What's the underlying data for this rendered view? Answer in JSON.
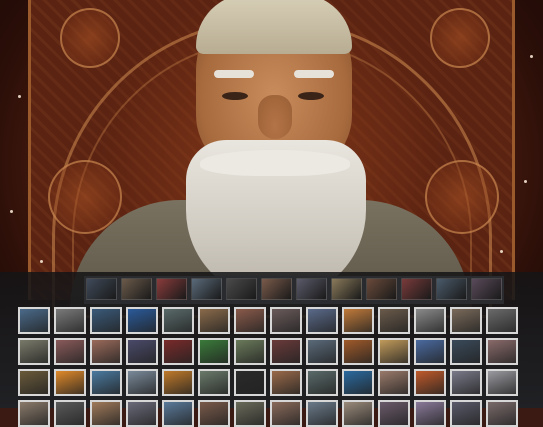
{
  "scene": {
    "subject": "elderly-sage-portrait",
    "palette": {
      "panel": "#5b2412",
      "gold_trim": "#c98a50",
      "beard": "#e9e6df",
      "robe": "#6e6656",
      "gallery_bg": "#202124"
    }
  },
  "strip_thumbnails": [
    "#3f4a5a",
    "#6b5a4a",
    "#8a3b3b",
    "#5a6a7a",
    "#4a4a4a",
    "#7a5a4a",
    "#5a5a6a",
    "#8a7a5a",
    "#6a4a3a",
    "#7a3a3a",
    "#4a5a6a",
    "#5a4a5a"
  ],
  "grid_thumbnails": [
    "#4a6a8a",
    "#7a7a7a",
    "#3a5a7a",
    "#2a5a9a",
    "#5a6a6a",
    "#8a6a4a",
    "#8a5a4a",
    "#6a5a5a",
    "#5a6a8a",
    "#c07a3a",
    "#6a5a4a",
    "#8a8a8a",
    "#7a6a5a",
    "#6a6a6a",
    "#7a7a6a",
    "#8a5a5a",
    "#9a6a5a",
    "#4a4a6a",
    "#7a2a2a",
    "#3a7a3a",
    "#6a7a5a",
    "#6a3a3a",
    "#5a6a7a",
    "#a05a2a",
    "#c09a5a",
    "#4a6aa0",
    "#3a4a5a",
    "#8a6a6a",
    "#6a5a3a",
    "#e08a2a",
    "#4a7aa0",
    "#7a8a9a",
    "#c07a2a",
    "#6a7a6a",
    "#2a2a2a",
    "#9a6a4a",
    "#5a6a6a",
    "#2a6aa0",
    "#9a7a6a",
    "#c05a2a",
    "#7a7a8a",
    "#9a9aa0",
    "#8a7a6a",
    "#5a5a5a",
    "#a07a5a",
    "#6a6a7a",
    "#5a7a9a",
    "#7a5a4a",
    "#6a6a5a",
    "#8a6a5a",
    "#6a7a8a",
    "#9a8a7a",
    "#6a5a6a",
    "#8a7a9a",
    "#5a5a6a",
    "#7a6a6a"
  ]
}
